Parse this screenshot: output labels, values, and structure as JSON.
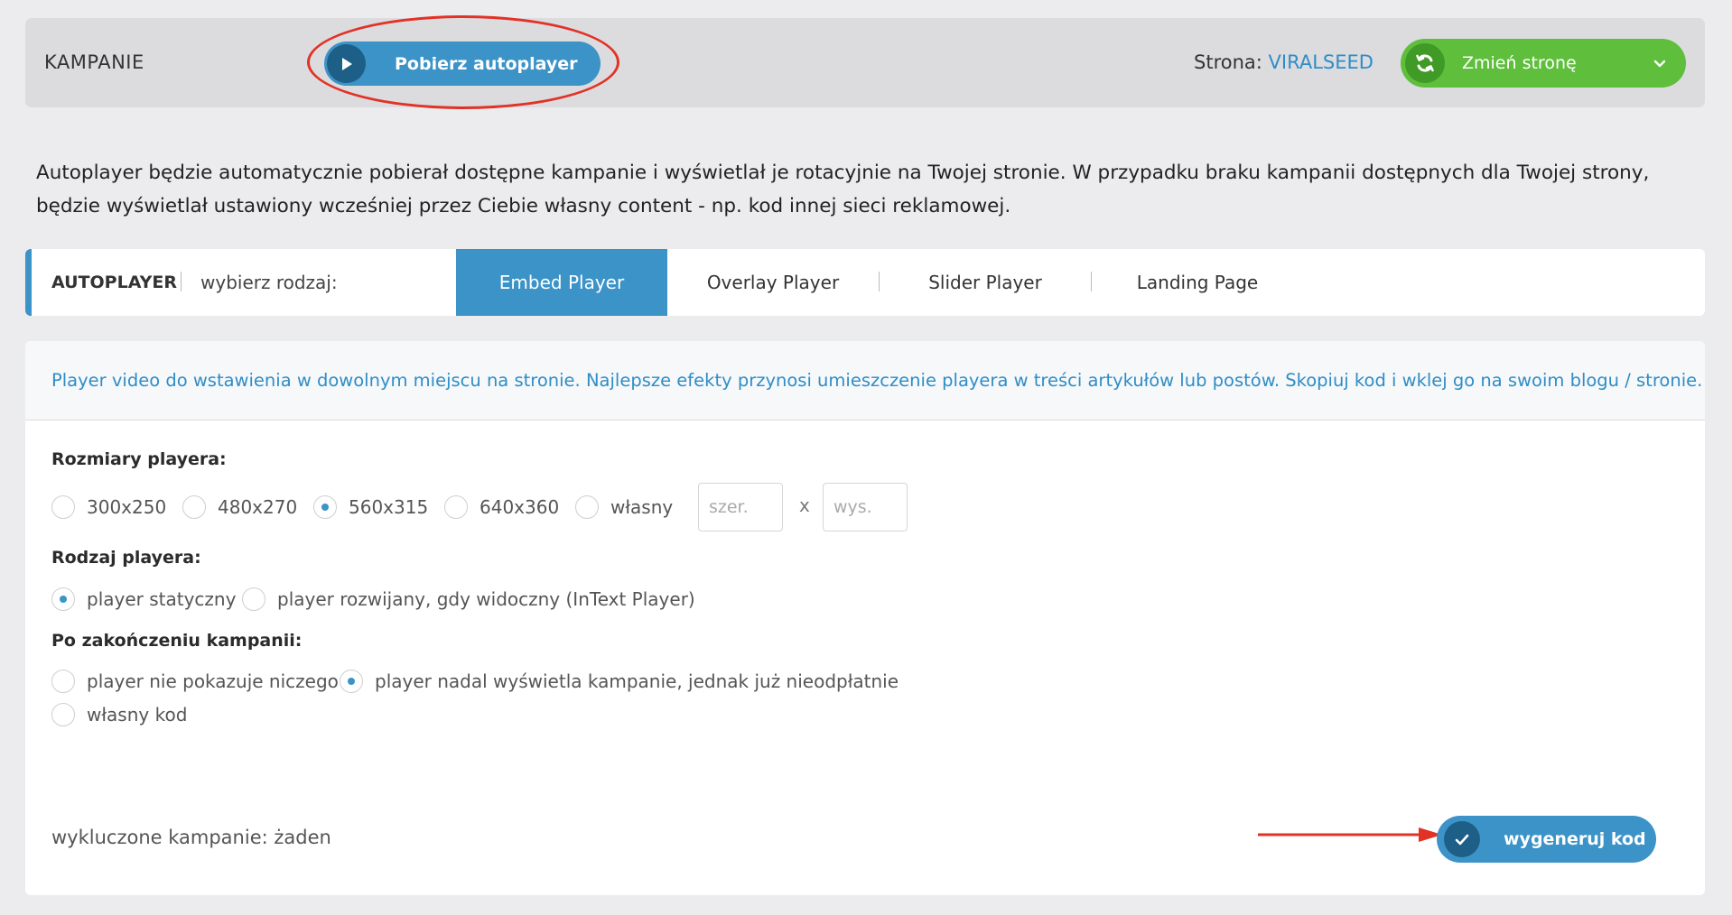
{
  "header": {
    "title": "KAMPANIE",
    "download_button": "Pobierz autoplayer",
    "site_label": "Strona:",
    "site_name": "VIRALSEED",
    "change_site_button": "Zmień stronę"
  },
  "intro_text": "Autoplayer będzie automatycznie pobierał dostępne kampanie i wyświetlał je rotacyjnie na Twojej stronie. W przypadku braku kampanii dostępnych dla Twojej strony, będzie wyświetlał ustawiony wcześniej przez Ciebie własny content - np. kod innej sieci reklamowej.",
  "autoplayer": {
    "title": "AUTOPLAYER",
    "choose_label": "wybierz rodzaj:",
    "tabs": [
      {
        "label": "Embed Player",
        "active": true
      },
      {
        "label": "Overlay Player",
        "active": false
      },
      {
        "label": "Slider Player",
        "active": false
      },
      {
        "label": "Landing Page",
        "active": false
      }
    ]
  },
  "panel": {
    "description": "Player video do wstawienia w dowolnym miejscu na stronie. Najlepsze efekty przynosi umieszczenie playera w treści artykułów lub postów. Skopiuj kod i wklej go na swoim blogu / stronie.",
    "sizes": {
      "label": "Rozmiary playera:",
      "options": [
        {
          "label": "300x250",
          "checked": false
        },
        {
          "label": "480x270",
          "checked": false
        },
        {
          "label": "560x315",
          "checked": true
        },
        {
          "label": "640x360",
          "checked": false
        },
        {
          "label": "własny",
          "checked": false
        }
      ],
      "width_placeholder": "szer.",
      "height_placeholder": "wys.",
      "times": "x"
    },
    "player_type": {
      "label": "Rodzaj playera:",
      "options": [
        {
          "label": "player statyczny",
          "checked": true
        },
        {
          "label": "player rozwijany, gdy widoczny (InText Player)",
          "checked": false
        }
      ]
    },
    "after_campaign": {
      "label": "Po zakończeniu kampanii:",
      "options": [
        {
          "label": "player nie pokazuje niczego",
          "checked": false
        },
        {
          "label": "player nadal wyświetla kampanie, jednak już nieodpłatnie",
          "checked": true
        },
        {
          "label": "własny kod",
          "checked": false
        }
      ]
    },
    "excluded_campaigns": "wykluczone kampanie: żaden",
    "generate_button": "wygeneruj kod"
  },
  "colors": {
    "accent_blue": "#3b93c7",
    "green": "#5fbe3c",
    "annotation_red": "#e23226",
    "link_blue": "#2f8dc6"
  }
}
